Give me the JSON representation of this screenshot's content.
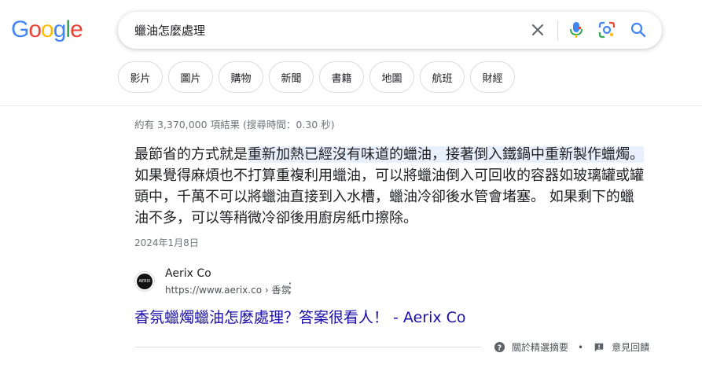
{
  "logo": {
    "letters": [
      "G",
      "o",
      "o",
      "g",
      "l",
      "e"
    ],
    "colors": [
      "#4285F4",
      "#EA4335",
      "#FBBC05",
      "#4285F4",
      "#34A853",
      "#EA4335"
    ]
  },
  "search": {
    "query": "蠟油怎麼處理"
  },
  "chips": [
    "影片",
    "圖片",
    "購物",
    "新聞",
    "書籍",
    "地圖",
    "航班",
    "財經"
  ],
  "stats": "約有 3,370,000 項結果 (搜尋時間：0.30 秒)",
  "snippet": {
    "part1": "最節省的方式就是",
    "highlight": "重新加熱已經沒有味道的蠟油，接著倒入鐵鍋中重新製作蠟燭。",
    "part2": " 如果覺得麻煩也不打算重複利用蠟油，可以將蠟油倒入可回收的容器如玻璃罐或罐頭中，千萬不可以將蠟油直接到入水槽，蠟油冷卻後水管會堵塞。 如果剩下的蠟油不多，可以等稍微冷卻後用廚房紙巾擦除。",
    "date": "2024年1月8日"
  },
  "source": {
    "site_name": "Aerix Co",
    "url": "https://www.aerix.co › 香氛",
    "favicon_text": "AERIX"
  },
  "result": {
    "title": "香氛蠟燭蠟油怎麼處理？答案很看人！ - Aerix Co"
  },
  "footer": {
    "about": "關於精選摘要",
    "feedback": "意見回饋"
  }
}
